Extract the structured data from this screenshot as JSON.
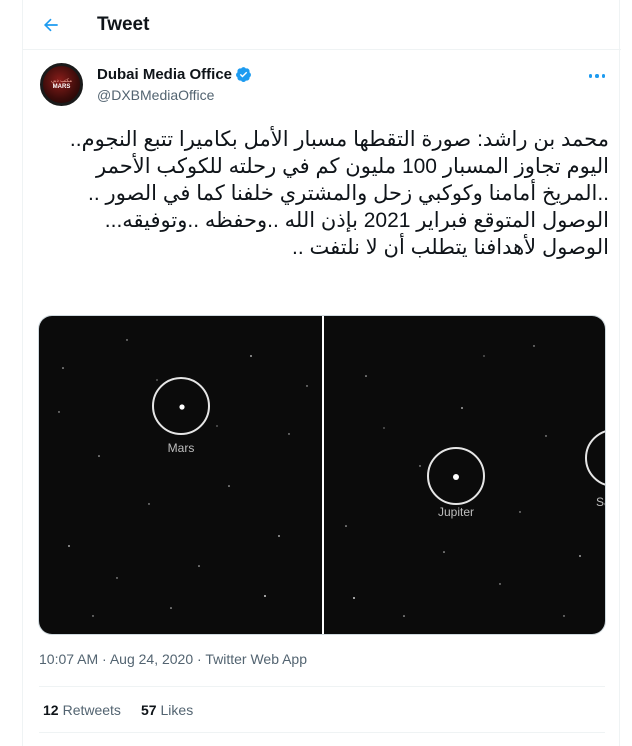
{
  "header": {
    "title": "Tweet",
    "back_icon": "arrow-left-icon"
  },
  "author": {
    "display_name": "Dubai Media Office",
    "handle": "@DXBMediaOffice",
    "verified_icon": "verified-badge-icon",
    "avatar_text_top": "مكتب دبي",
    "avatar_text_main": "MARS"
  },
  "tweet": {
    "text": "محمد بن راشد: صورة التقطها مسبار الأمل بكاميرا تتبع النجوم.. اليوم تجاوز المسبار 100 مليون كم في رحلته للكوكب الأحمر ..المريخ أمامنا وكوكبي زحل والمشتري خلفنا كما في الصور .. الوصول المتوقع فبراير  2021 بإذن الله ..وحفظه ..وتوفيقه...\nالوصول لأهدافنا يتطلب أن لا نلتفت .."
  },
  "media": {
    "left": {
      "label": "Mars"
    },
    "right": {
      "label": "Jupiter",
      "partial_label": "Sa"
    }
  },
  "meta": {
    "time": "10:07 AM",
    "date": "Aug 24, 2020",
    "separator": " · ",
    "source": "Twitter Web App"
  },
  "stats": {
    "retweets_count": "12",
    "retweets_label": "Retweets",
    "likes_count": "57",
    "likes_label": "Likes"
  },
  "colors": {
    "accent": "#1d9bf0",
    "text": "#0f1419",
    "muted": "#536471",
    "border": "#eff3f4"
  }
}
